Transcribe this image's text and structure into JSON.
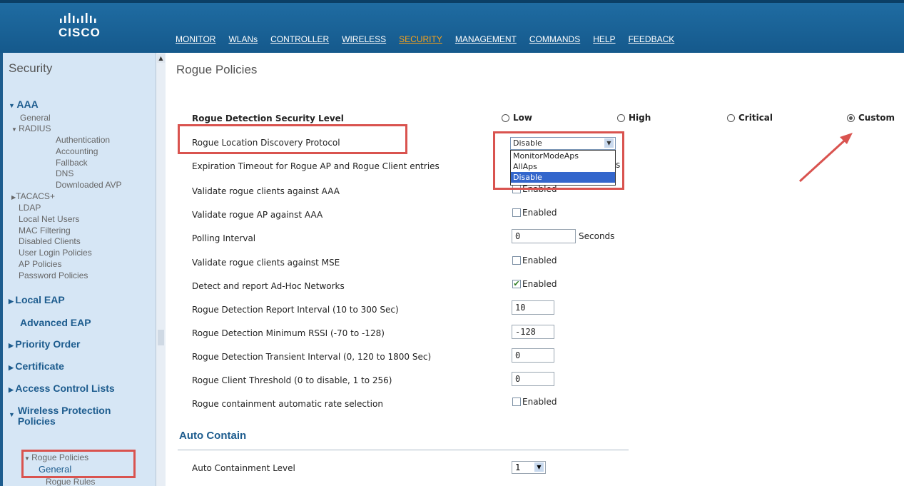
{
  "brand": {
    "name": "CISCO"
  },
  "nav": [
    {
      "label": "MONITOR"
    },
    {
      "label": "WLANs"
    },
    {
      "label": "CONTROLLER"
    },
    {
      "label": "WIRELESS"
    },
    {
      "label": "SECURITY",
      "active": true
    },
    {
      "label": "MANAGEMENT"
    },
    {
      "label": "COMMANDS"
    },
    {
      "label": "HELP"
    },
    {
      "label": "FEEDBACK"
    }
  ],
  "sidebar": {
    "title": "Security",
    "items": {
      "aaa": "AAA",
      "general": "General",
      "radius": "RADIUS",
      "authentication": "Authentication",
      "accounting": "Accounting",
      "fallback": "Fallback",
      "dns": "DNS",
      "downloaded_avp": "Downloaded AVP",
      "tacacs": "TACACS+",
      "ldap": "LDAP",
      "local_net_users": "Local Net Users",
      "mac_filtering": "MAC Filtering",
      "disabled_clients": "Disabled Clients",
      "user_login_policies": "User Login Policies",
      "ap_policies": "AP Policies",
      "password_policies": "Password Policies",
      "local_eap": "Local EAP",
      "advanced_eap": "Advanced EAP",
      "priority_order": "Priority Order",
      "certificate": "Certificate",
      "acl": "Access Control Lists",
      "wpp_line1": "Wireless Protection",
      "wpp_line2": "Policies",
      "rogue_policies": "Rogue Policies",
      "rogue_general": "General",
      "rogue_rules": "Rogue Rules"
    }
  },
  "page": {
    "title": "Rogue Policies"
  },
  "security_level": {
    "label": "Rogue Detection Security Level",
    "options": {
      "low": "Low",
      "high": "High",
      "critical": "Critical",
      "custom": "Custom"
    },
    "selected": "Custom"
  },
  "rldp": {
    "label": "Rogue Location Discovery Protocol",
    "value": "Disable",
    "options": [
      "MonitorModeAps",
      "AllAps",
      "Disable"
    ]
  },
  "fields": {
    "expiration_label": "Expiration Timeout for Rogue AP and Rogue Client entries",
    "expiration_unit_fragment": "s",
    "validate_clients_aaa_label": "Validate rogue clients against AAA",
    "validate_clients_aaa_value": "Enabled",
    "validate_ap_aaa_label": "Validate rogue AP against AAA",
    "enabled_text": "Enabled",
    "polling_label": "Polling Interval",
    "polling_value": "0",
    "polling_unit": "Seconds",
    "validate_clients_mse_label": "Validate rogue clients against MSE",
    "adhoc_label": "Detect and report Ad-Hoc Networks",
    "report_interval_label": "Rogue Detection Report Interval (10 to 300 Sec)",
    "report_interval_value": "10",
    "min_rssi_label": "Rogue Detection Minimum RSSI (-70 to -128)",
    "min_rssi_value": "-128",
    "transient_label": "Rogue Detection Transient Interval (0, 120 to 1800 Sec)",
    "transient_value": "0",
    "client_threshold_label": "Rogue Client Threshold (0 to disable, 1 to 256)",
    "client_threshold_value": "0",
    "containment_rate_label": "Rogue containment automatic rate selection"
  },
  "auto_contain": {
    "title": "Auto Contain",
    "level_label": "Auto Containment Level",
    "level_value": "1"
  },
  "colors": {
    "header": "#1f6ca2",
    "active_nav": "#f7a21b",
    "sidebar_bg": "#d6e6f5",
    "heading": "#1d5c8e",
    "highlight_box": "#d9534f",
    "selected_option": "#3366cc"
  }
}
